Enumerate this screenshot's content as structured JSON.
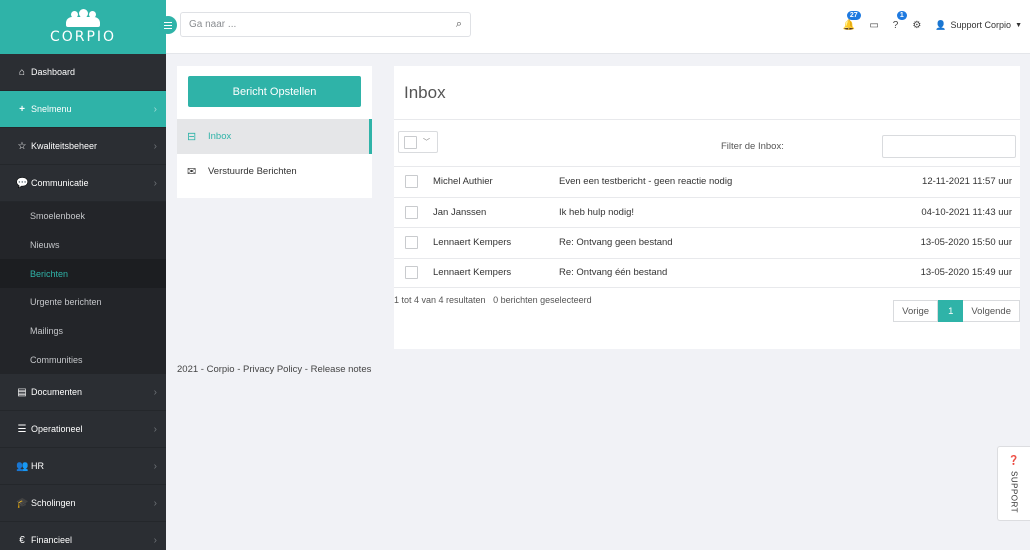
{
  "brand": {
    "name": "CORPIO"
  },
  "search": {
    "placeholder": "Ga naar ..."
  },
  "topbar": {
    "notifications_count": "27",
    "help_count": "1",
    "user_name": "Support Corpio"
  },
  "sidebar": {
    "items": [
      {
        "label": "Dashboard",
        "icon": "home-icon"
      },
      {
        "label": "Snelmenu",
        "icon": "plus-icon"
      },
      {
        "label": "Kwaliteitsbeheer",
        "icon": "star-icon"
      },
      {
        "label": "Communicatie",
        "icon": "chat-icon"
      },
      {
        "label": "Documenten",
        "icon": "document-icon"
      },
      {
        "label": "Operationeel",
        "icon": "list-icon"
      },
      {
        "label": "HR",
        "icon": "people-icon"
      },
      {
        "label": "Scholingen",
        "icon": "graduation-cap-icon"
      },
      {
        "label": "Financieel",
        "icon": "euro-icon"
      }
    ],
    "subitems": [
      {
        "label": "Smoelenboek"
      },
      {
        "label": "Nieuws"
      },
      {
        "label": "Berichten"
      },
      {
        "label": "Urgente berichten"
      },
      {
        "label": "Mailings"
      },
      {
        "label": "Communities"
      }
    ]
  },
  "mail": {
    "compose_label": "Bericht Opstellen",
    "folders": [
      {
        "label": "Inbox",
        "icon": "inbox-icon"
      },
      {
        "label": "Verstuurde Berichten",
        "icon": "envelope-icon"
      }
    ]
  },
  "inbox": {
    "title": "Inbox",
    "filter_label": "Filter de Inbox:",
    "rows": [
      {
        "from": "Michel Authier",
        "subject": "Even een testbericht - geen reactie nodig",
        "date": "12-11-2021 11:57 uur"
      },
      {
        "from": "Jan Janssen",
        "subject": "Ik heb hulp nodig!",
        "date": "04-10-2021 11:43 uur"
      },
      {
        "from": "Lennaert Kempers",
        "subject": "Re: Ontvang geen bestand",
        "date": "13-05-2020 15:50 uur"
      },
      {
        "from": "Lennaert Kempers",
        "subject": "Re: Ontvang één bestand",
        "date": "13-05-2020 15:49 uur"
      }
    ],
    "result_info": "1 tot 4 van 4 resultaten",
    "selected_info": "0 berichten geselecteerd",
    "pager": {
      "prev": "Vorige",
      "page": "1",
      "next": "Volgende"
    }
  },
  "footer": {
    "year": "2021",
    "brand": "Corpio",
    "privacy": "Privacy Policy",
    "release": "Release notes"
  },
  "support": {
    "label": "SUPPORT"
  },
  "colors": {
    "accent": "#2fb3a8",
    "sidebar": "#2b2e33",
    "badge": "#1f7ae0"
  }
}
